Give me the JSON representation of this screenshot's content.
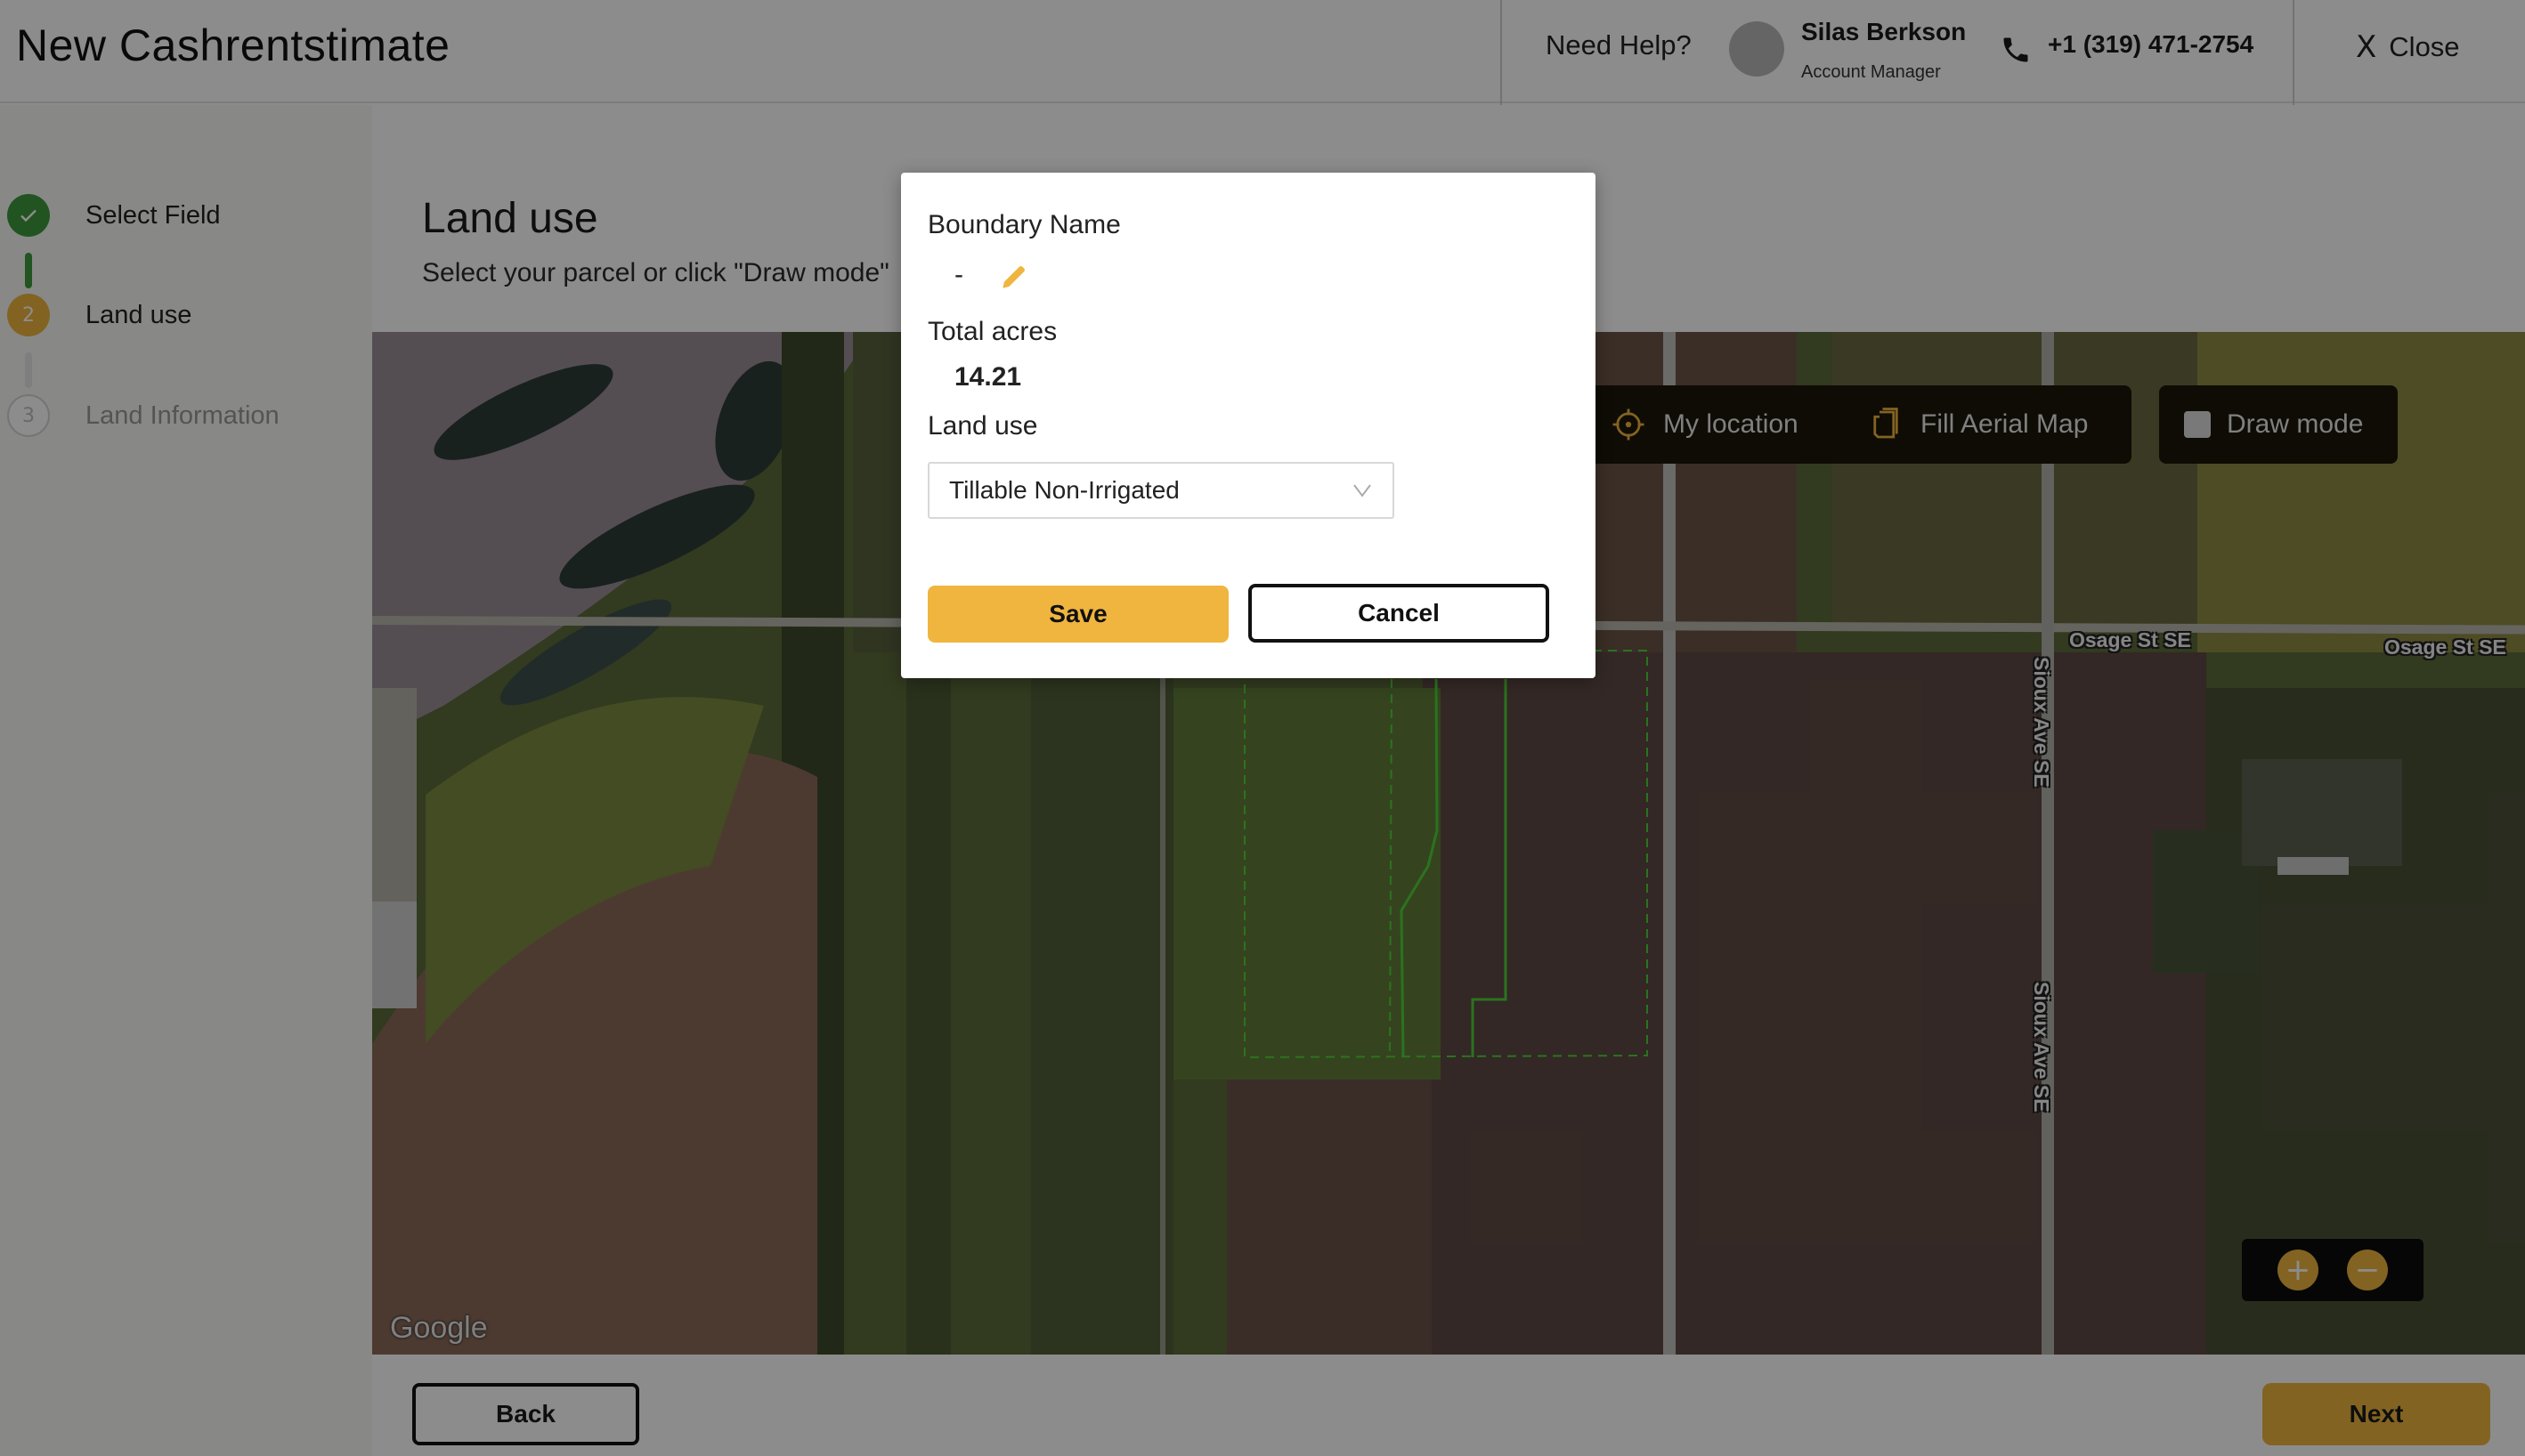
{
  "header": {
    "app_title": "New Cashrentstimate",
    "help_text": "Need Help?",
    "manager": {
      "name": "Silas Berkson",
      "role": "Account Manager",
      "phone": "+1 (319) 471-2754"
    },
    "close_label": "Close",
    "close_icon": "X"
  },
  "steps": [
    {
      "number": "1",
      "label": "Select Field",
      "state": "done"
    },
    {
      "number": "2",
      "label": "Land use",
      "state": "active"
    },
    {
      "number": "3",
      "label": "Land Information",
      "state": "todo"
    }
  ],
  "main": {
    "heading": "Land use",
    "subtitle": "Select your parcel or click \"Draw mode\""
  },
  "map": {
    "buttons": {
      "my_location": "My location",
      "fill_aerial": "Fill Aerial Map",
      "draw_mode": "Draw mode"
    },
    "draw_mode_checked": false,
    "streets": {
      "osage_1": "Osage St SE",
      "osage_2": "Osage St SE",
      "sioux_1": "Sioux Ave SE",
      "sioux_2": "Sioux Ave SE"
    },
    "attribution": "Google",
    "zoom_in": "+",
    "zoom_out": "−",
    "boundary_color": "#4fd23a"
  },
  "modal": {
    "boundary_name_label": "Boundary Name",
    "boundary_name_value": "-",
    "total_acres_label": "Total acres",
    "total_acres_value": "14.21",
    "land_use_label": "Land use",
    "land_use_selected": "Tillable Non-Irrigated",
    "save_label": "Save",
    "cancel_label": "Cancel"
  },
  "footer": {
    "back_label": "Back",
    "next_label": "Next"
  },
  "colors": {
    "accent": "#efb53f",
    "success": "#3d9a3d"
  }
}
